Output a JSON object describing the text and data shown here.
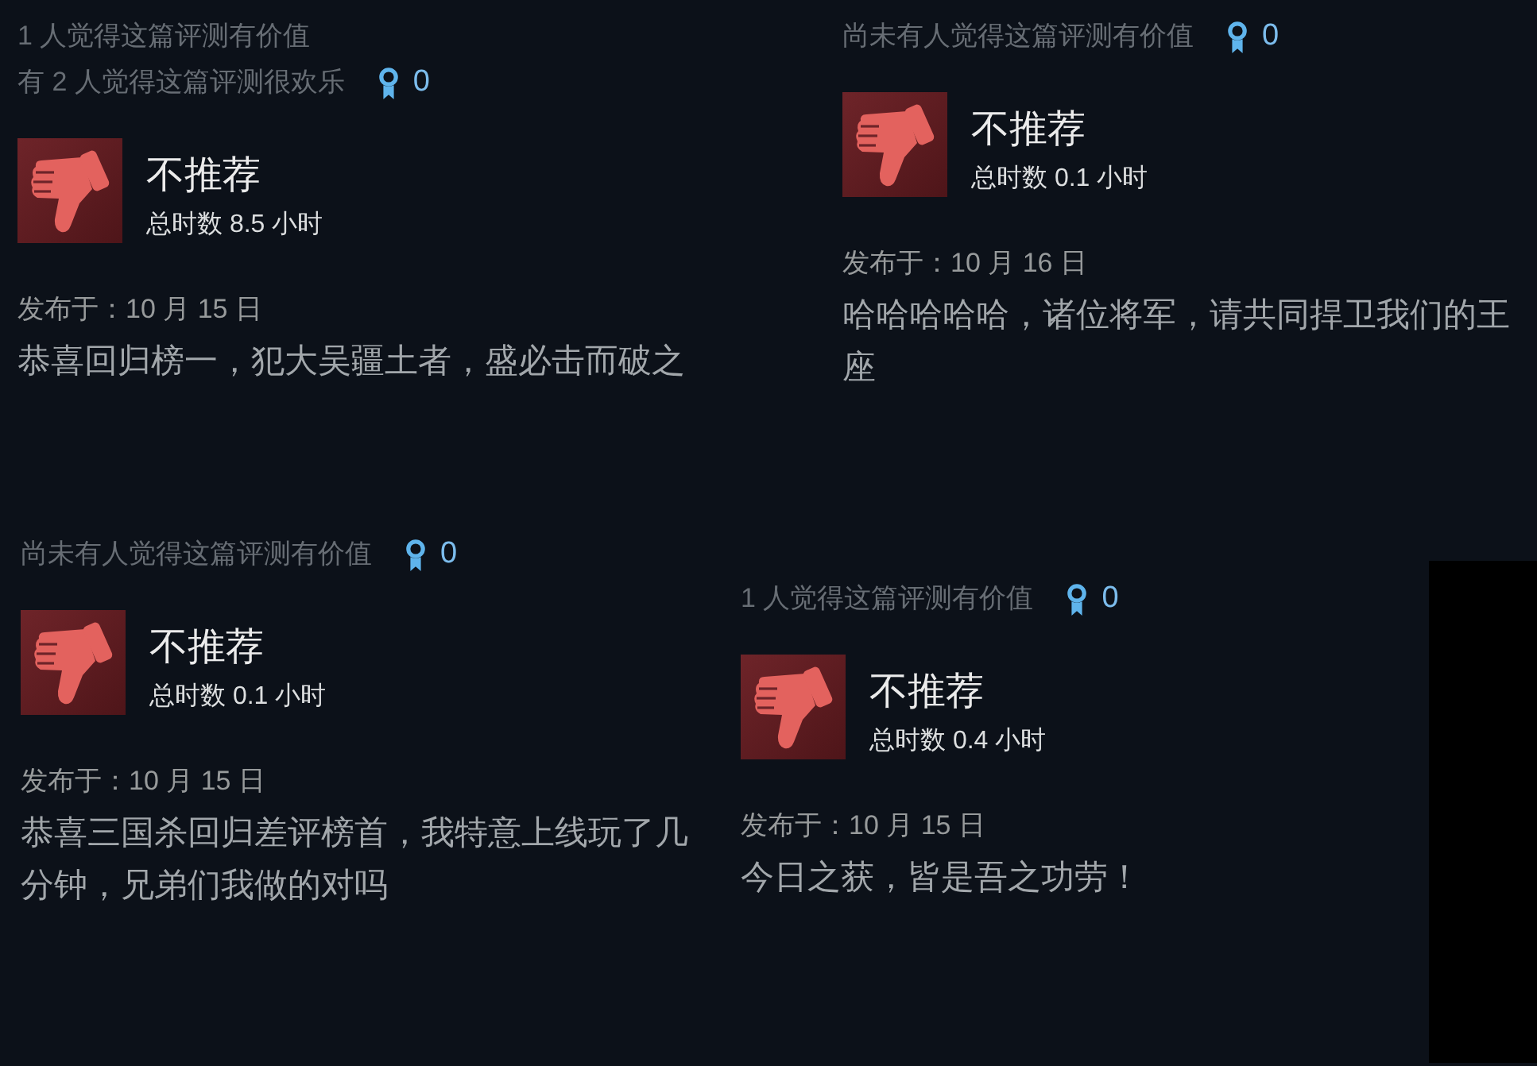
{
  "reviews": [
    {
      "helpful": [
        "1 人觉得这篇评测有价值",
        "有 2 人觉得这篇评测很欢乐"
      ],
      "award_count": "0",
      "recommended": false,
      "verdict": "不推荐",
      "hours": "总时数 8.5 小时",
      "posted": "发布于：10 月 15 日",
      "body": "恭喜回归榜一，犯大吴疆土者，盛必击而破之"
    },
    {
      "helpful": [
        "尚未有人觉得这篇评测有价值"
      ],
      "award_count": "0",
      "recommended": false,
      "verdict": "不推荐",
      "hours": "总时数 0.1 小时",
      "posted": "发布于：10 月 16 日",
      "body": "哈哈哈哈哈，诸位将军，请共同捍卫我们的王座"
    },
    {
      "helpful": [
        "尚未有人觉得这篇评测有价值"
      ],
      "award_count": "0",
      "recommended": false,
      "verdict": "不推荐",
      "hours": "总时数 0.1 小时",
      "posted": "发布于：10 月 15 日",
      "body": "恭喜三国杀回归差评榜首，我特意上线玩了几分钟，兄弟们我做的对吗"
    },
    {
      "helpful": [
        "1 人觉得这篇评测有价值"
      ],
      "award_count": "0",
      "recommended": false,
      "verdict": "不推荐",
      "hours": "总时数 0.4 小时",
      "posted": "发布于：10 月 15 日",
      "body": "今日之获，皆是吾之功劳！"
    }
  ]
}
